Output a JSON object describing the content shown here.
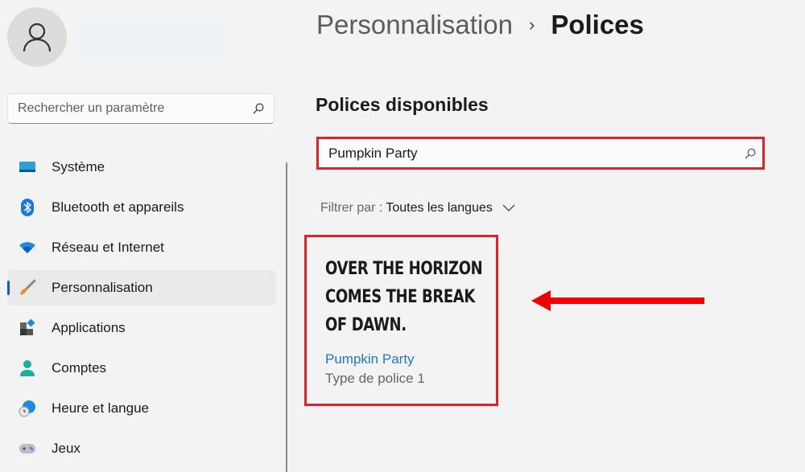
{
  "sidebar": {
    "search_placeholder": "Rechercher un paramètre",
    "items": [
      {
        "label": "Système",
        "icon": "monitor-icon"
      },
      {
        "label": "Bluetooth et appareils",
        "icon": "bluetooth-icon"
      },
      {
        "label": "Réseau et Internet",
        "icon": "wifi-icon"
      },
      {
        "label": "Personnalisation",
        "icon": "paintbrush-icon",
        "active": true
      },
      {
        "label": "Applications",
        "icon": "apps-icon"
      },
      {
        "label": "Comptes",
        "icon": "person-icon"
      },
      {
        "label": "Heure et langue",
        "icon": "globe-clock-icon"
      },
      {
        "label": "Jeux",
        "icon": "gamepad-icon"
      }
    ]
  },
  "header": {
    "parent": "Personnalisation",
    "separator": "›",
    "current": "Polices"
  },
  "main": {
    "section_title": "Polices disponibles",
    "font_search_value": "Pumpkin Party",
    "filter_label": "Filtrer par :",
    "filter_value": "Toutes les langues",
    "font_card": {
      "sample": "Over the horizon comes the break of dawn.",
      "name": "Pumpkin Party",
      "type": "Type de police 1"
    }
  },
  "colors": {
    "accent": "#0067c0",
    "annotation": "#d7262e",
    "arrow": "#ee0000",
    "link": "#1f78c1"
  }
}
